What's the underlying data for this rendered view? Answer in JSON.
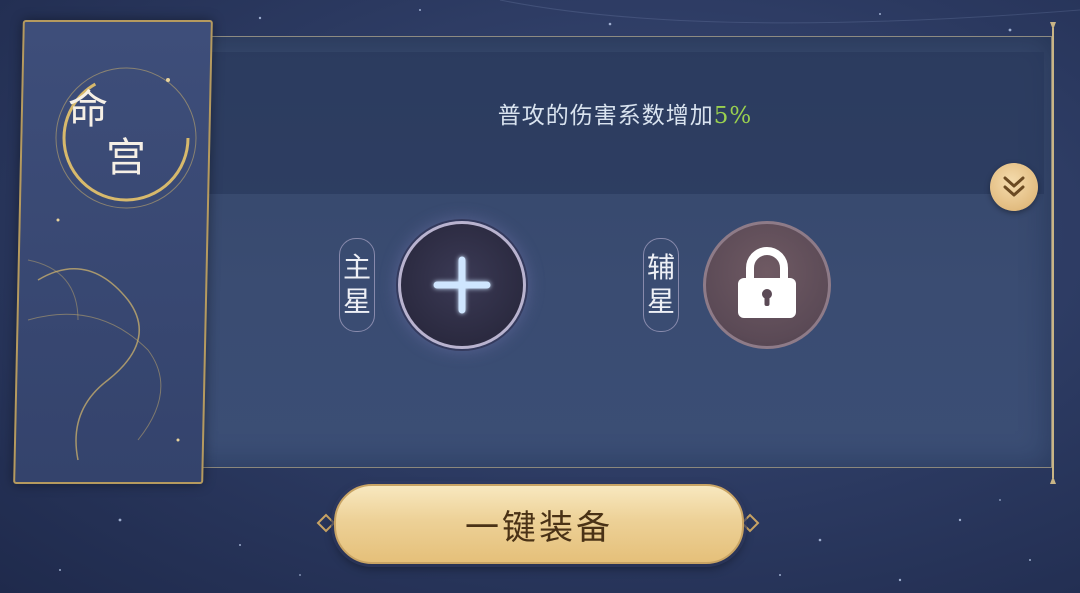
{
  "side_tab": {
    "title_line1": "命",
    "title_line2": "宫"
  },
  "bonus_text": {
    "prefix": "普攻的伤害系数增加",
    "value": "5%"
  },
  "slots": {
    "main": {
      "label_top": "主",
      "label_bottom": "星",
      "state": "empty",
      "icon": "plus-icon"
    },
    "secondary": {
      "label_top": "辅",
      "label_bottom": "星",
      "state": "locked",
      "icon": "lock-icon"
    }
  },
  "expand_button": {
    "icon": "double-chevron-down-icon"
  },
  "equip_button": {
    "label": "一键装备"
  },
  "colors": {
    "accent_gold": "#e5c07a",
    "bonus_green": "#9ad14f",
    "panel": "#3a4c72"
  }
}
